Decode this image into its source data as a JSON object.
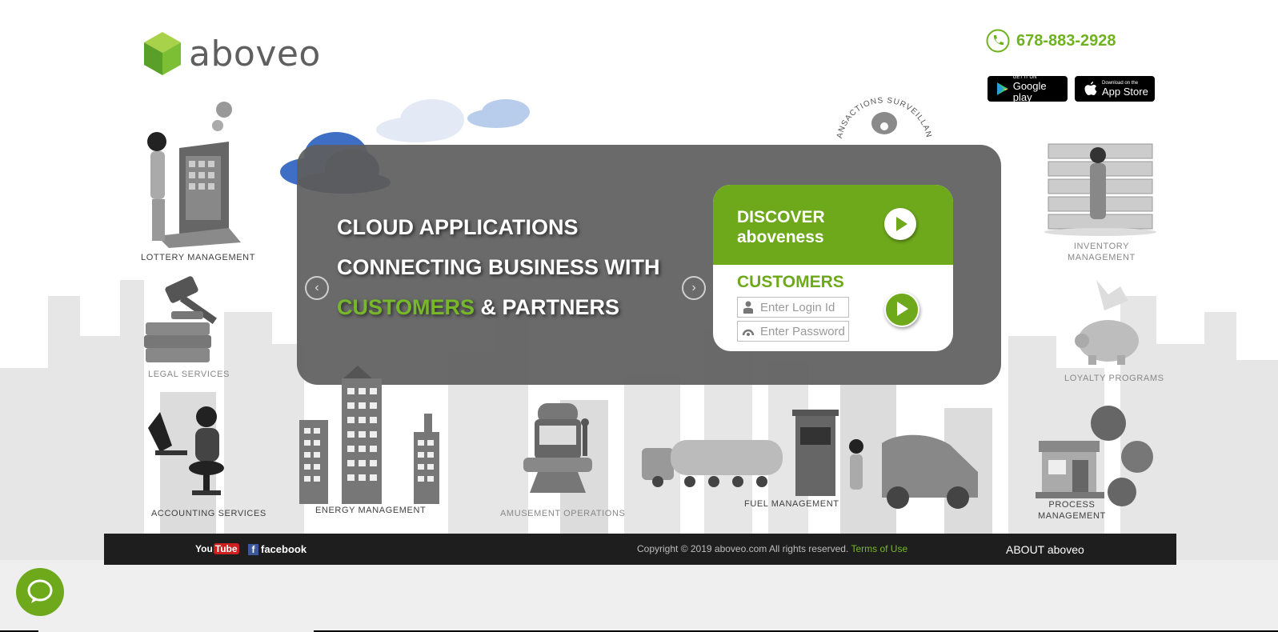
{
  "brand": {
    "name": "aboveo"
  },
  "header": {
    "phone": "678-883-2928"
  },
  "stores": {
    "google": {
      "small": "GET IT ON",
      "big": "Google play"
    },
    "apple": {
      "small": "Download on the",
      "big": "App Store"
    }
  },
  "surveillance_label": "TRANSACTIONS SURVEILLANCE",
  "hero": {
    "line1": "CLOUD APPLICATIONS",
    "line2": "CONNECTING BUSINESS WITH",
    "line3_accent": "CUSTOMERS",
    "line3_rest": " & PARTNERS",
    "prev_arrow": "‹",
    "next_arrow": "›"
  },
  "discover": {
    "line1": "DISCOVER",
    "line2": "aboveness"
  },
  "login": {
    "title": "CUSTOMERS",
    "login_placeholder": "Enter Login Id",
    "password_placeholder": "Enter Password"
  },
  "services": {
    "lottery": "LOTTERY MANAGEMENT",
    "legal": "LEGAL SERVICES",
    "accounting": "ACCOUNTING SERVICES",
    "energy": "ENERGY MANAGEMENT",
    "amusement": "AMUSEMENT OPERATIONS",
    "fuel": "FUEL MANAGEMENT",
    "inventory_1": "INVENTORY",
    "inventory_2": "MANAGEMENT",
    "loyalty": "LOYALTY PROGRAMS",
    "process_1": "PROCESS",
    "process_2": "MANAGEMENT"
  },
  "footer": {
    "youtube_you": "You",
    "youtube_tube": "Tube",
    "facebook_f": "f",
    "facebook": "facebook",
    "copyright": "Copyright © 2019 aboveo.com All rights reserved.",
    "terms": "Terms of Use",
    "about": "ABOUT aboveo"
  },
  "colors": {
    "accent": "#76b82a",
    "panel": "#5f5f5f",
    "footer": "#1e1e1e"
  }
}
